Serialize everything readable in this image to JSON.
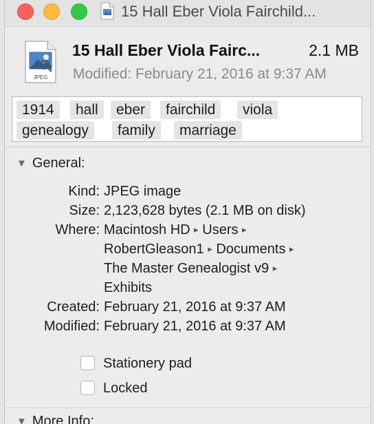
{
  "window": {
    "title": "15 Hall Eber Viola Fairchild..."
  },
  "header": {
    "file_name": "15 Hall Eber Viola Fairc...",
    "file_size": "2.1 MB",
    "modified": "Modified: February 21, 2016 at 9:37 AM",
    "icon_caption": "JPEG"
  },
  "tags": [
    "1914",
    "hall",
    "eber",
    "fairchild",
    "viola",
    "genealogy",
    "family",
    "marriage"
  ],
  "general": {
    "heading": "General:",
    "kind_label": "Kind:",
    "kind_value": "JPEG image",
    "size_label": "Size:",
    "size_value": "2,123,628 bytes (2.1 MB on disk)",
    "where_label": "Where:",
    "where_path": [
      "Macintosh HD",
      "Users",
      "RobertGleason1",
      "Documents",
      "The Master Genealogist v9",
      "Exhibits"
    ],
    "path_separator": "▸",
    "created_label": "Created:",
    "created_value": "February 21, 2016 at 9:37 AM",
    "modified_label": "Modified:",
    "modified_value": "February 21, 2016 at 9:37 AM",
    "stationery_label": "Stationery pad",
    "stationery_checked": false,
    "locked_label": "Locked",
    "locked_checked": false
  },
  "more_info": {
    "heading": "More Info:"
  },
  "icons": {
    "title": "jpeg-file-icon",
    "header": "jpeg-file-icon",
    "disclosure": "disclosure-triangle-icon"
  }
}
